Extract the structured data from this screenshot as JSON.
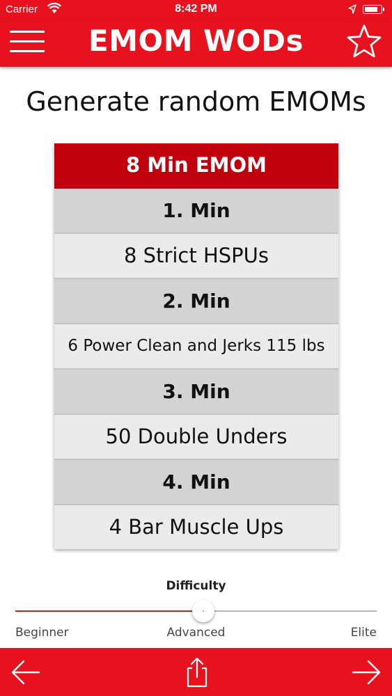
{
  "status_bar": {
    "carrier": "Carrier",
    "time": "8:42 PM"
  },
  "nav": {
    "title": "EMOM WODs",
    "menu_icon": "hamburger-menu-icon",
    "favorite_icon": "star-icon"
  },
  "heading": "Generate random EMOMs",
  "workout": {
    "title": "8 Min EMOM",
    "rows": [
      {
        "type": "minute",
        "text": "1. Min"
      },
      {
        "type": "exercise",
        "text": "8 Strict HSPUs"
      },
      {
        "type": "minute",
        "text": "2. Min"
      },
      {
        "type": "exercise",
        "text": "6 Power Clean and Jerks 115 lbs"
      },
      {
        "type": "minute",
        "text": "3. Min"
      },
      {
        "type": "exercise",
        "text": "50 Double Unders"
      },
      {
        "type": "minute",
        "text": "4. Min"
      },
      {
        "type": "exercise",
        "text": "4 Bar Muscle Ups"
      }
    ]
  },
  "difficulty": {
    "label": "Difficulty",
    "value": 0.52,
    "levels": [
      "Beginner",
      "Advanced",
      "Elite"
    ]
  },
  "toolbar": {
    "back_icon": "arrow-left-icon",
    "share_icon": "share-icon",
    "forward_icon": "arrow-right-icon"
  },
  "colors": {
    "brand_red": "#e8121e",
    "header_dark_red": "#c0000c",
    "minute_row_gray": "#d3d3d3",
    "exercise_row_gray": "#ebebeb"
  }
}
